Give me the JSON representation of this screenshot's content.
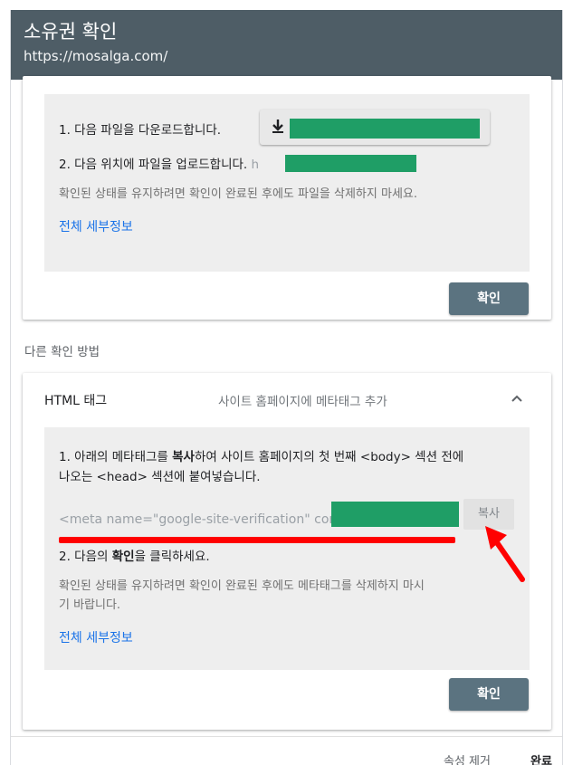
{
  "header": {
    "title": "소유권 확인",
    "url": "https://mosalga.com/"
  },
  "file_method": {
    "step1": "1. 다음 파일을 다운로드합니다.",
    "download_label": "",
    "step2": "2. 다음 위치에 파일을 업로드합니다.",
    "step2_url_prefix": "h",
    "note": "확인된 상태를 유지하려면 확인이 완료된 후에도 파일을 삭제하지 마세요.",
    "details_link": "전체 세부정보",
    "confirm": "확인"
  },
  "other_methods_label": "다른 확인 방법",
  "html_tag": {
    "title": "HTML 태그",
    "description": "사이트 홈페이지에 메타태그 추가",
    "step1_a": "1. 아래의 메타태그를 ",
    "step1_b": "복사",
    "step1_c": "하여 사이트 홈페이지의 첫 번째 <body> 섹션 전에",
    "step1_d": "나오는 <head> 섹션에 붙여넣습니다.",
    "meta_text": "<meta name=\"google-site-verification\" cont",
    "copy": "복사",
    "step2_a": "2. 다음의 ",
    "step2_b": "확인",
    "step2_c": "을 클릭하세요.",
    "note_line1": "확인된 상태를 유지하려면 확인이 완료된 후에도 메타태그를 삭제하지 마시",
    "note_line2": "기 바랍니다.",
    "details_link": "전체 세부정보",
    "confirm": "확인"
  },
  "footer": {
    "remove": "속성 제거",
    "done": "완료"
  },
  "colors": {
    "header_bg": "#4e5d66",
    "accent_link": "#1a73e8",
    "confirm_bg": "#5b7380",
    "redaction_green": "#1f9e66",
    "highlight_red": "#ff0000"
  },
  "icons": [
    "download-icon",
    "chevron-up-icon",
    "annotation-arrow"
  ]
}
